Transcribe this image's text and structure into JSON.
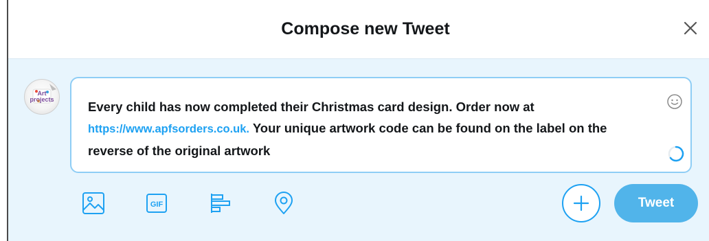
{
  "dialog": {
    "title": "Compose new Tweet",
    "close_icon": "close-icon"
  },
  "avatar": {
    "logo_text": "Art projects"
  },
  "composer": {
    "text_before_link": "Every child has now completed their Christmas card design. Order now at ",
    "link": "https://www.apfsorders.co.uk.",
    "text_after_link": " Your unique artwork code can be found on the label on the reverse of the original artwork",
    "emoji_icon": "smiley-icon",
    "progress_icon": "character-count-ring"
  },
  "toolbar": {
    "icons": [
      "image-icon",
      "gif-icon",
      "poll-icon",
      "location-icon"
    ],
    "gif_label": "GIF",
    "add_icon": "plus-icon",
    "tweet_label": "Tweet"
  },
  "colors": {
    "accent": "#1da1f2",
    "tweet_button": "#51b4ea",
    "composer_bg": "#e8f5fd",
    "text": "#14171a"
  }
}
